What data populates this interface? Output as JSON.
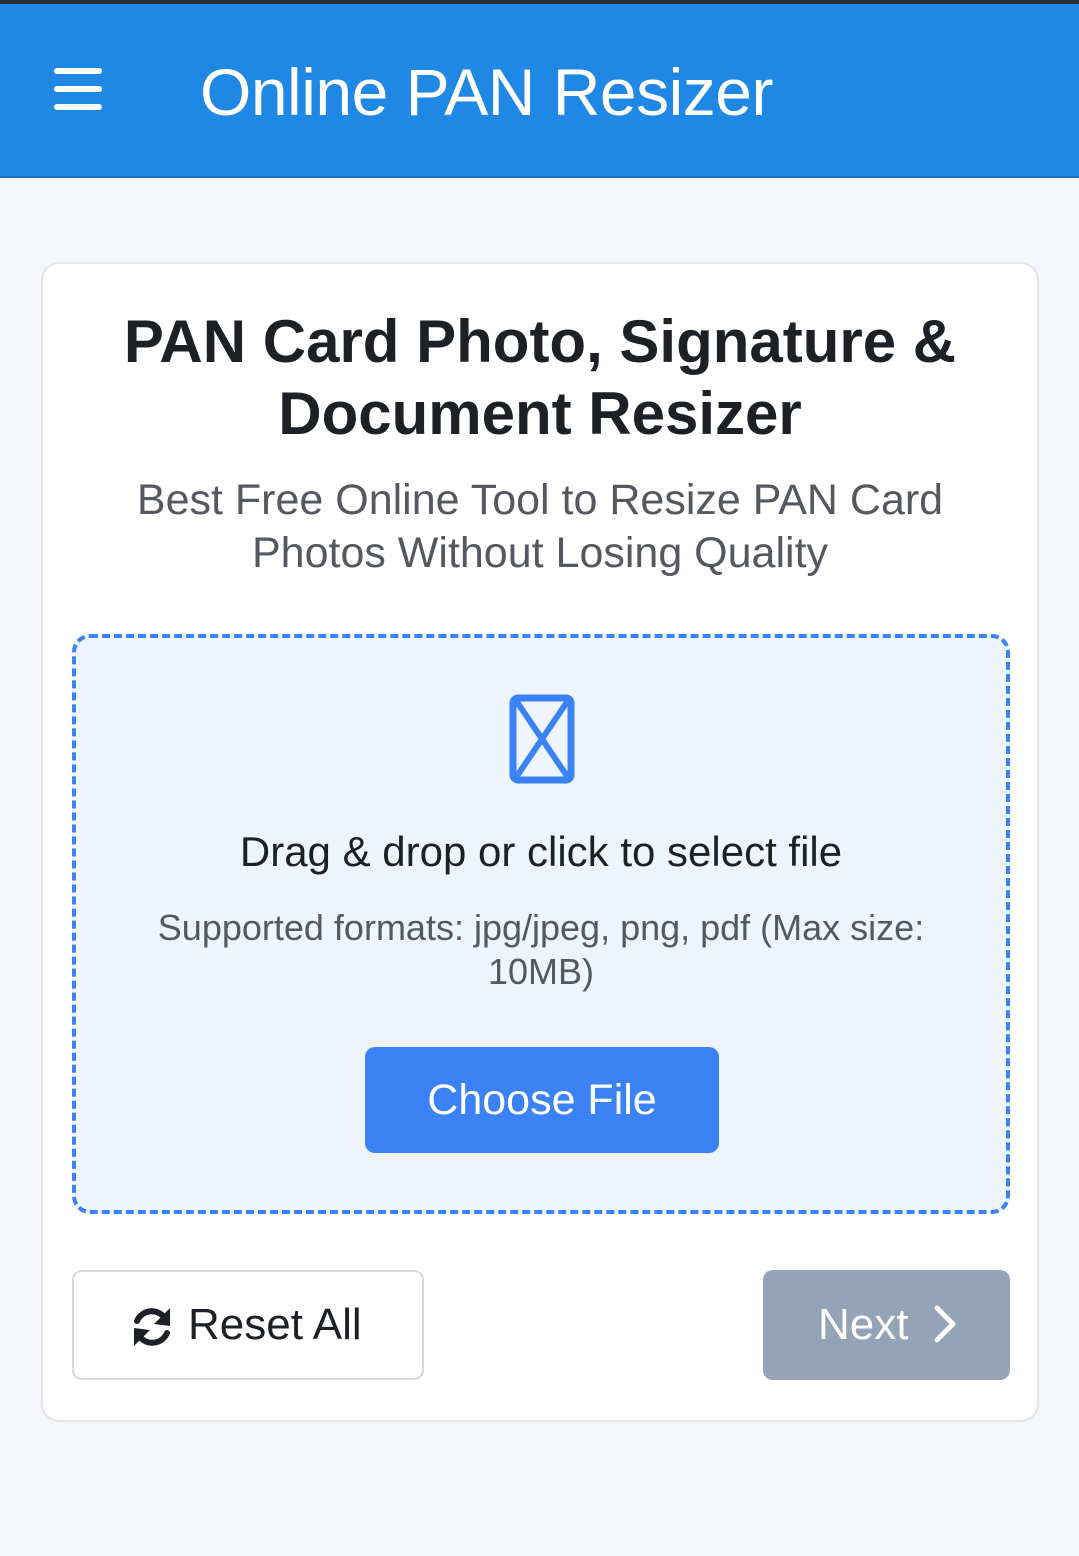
{
  "header": {
    "title": "Online PAN Resizer",
    "menu_icon": "hamburger-menu-icon",
    "background_color": "#1f88e5"
  },
  "card": {
    "title": "PAN Card Photo, Signature & Document Resizer",
    "subtitle": "Best Free Online Tool to Resize PAN Card Photos Without Losing Quality"
  },
  "dropzone": {
    "icon": "file-upload-icon",
    "main_text": "Drag & drop or click to select file",
    "formats_text": "Supported formats: jpg/jpeg, png, pdf (Max size: 10MB)",
    "choose_button_label": "Choose File",
    "accent_color": "#3b82f6"
  },
  "actions": {
    "reset_label": "Reset All",
    "reset_icon": "refresh-icon",
    "next_label": "Next",
    "next_icon": "chevron-right-icon",
    "next_disabled_color": "#94a3b8"
  }
}
